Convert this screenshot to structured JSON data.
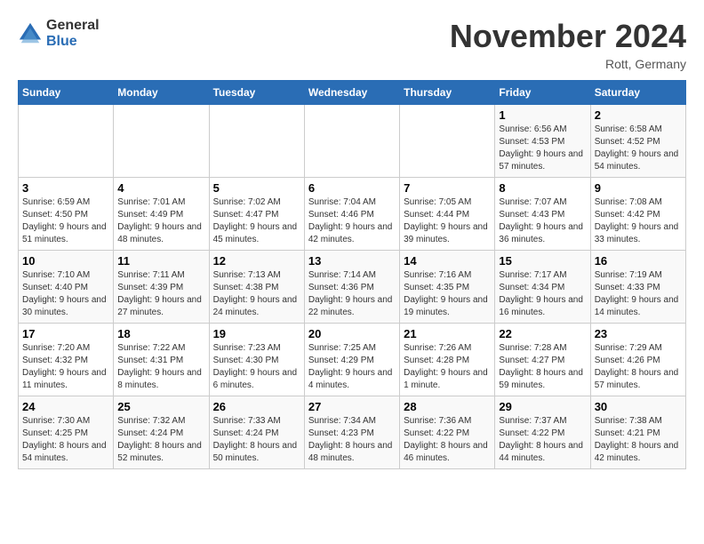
{
  "logo": {
    "general": "General",
    "blue": "Blue"
  },
  "title": "November 2024",
  "location": "Rott, Germany",
  "days_of_week": [
    "Sunday",
    "Monday",
    "Tuesday",
    "Wednesday",
    "Thursday",
    "Friday",
    "Saturday"
  ],
  "weeks": [
    [
      {
        "day": "",
        "info": ""
      },
      {
        "day": "",
        "info": ""
      },
      {
        "day": "",
        "info": ""
      },
      {
        "day": "",
        "info": ""
      },
      {
        "day": "",
        "info": ""
      },
      {
        "day": "1",
        "info": "Sunrise: 6:56 AM\nSunset: 4:53 PM\nDaylight: 9 hours and 57 minutes."
      },
      {
        "day": "2",
        "info": "Sunrise: 6:58 AM\nSunset: 4:52 PM\nDaylight: 9 hours and 54 minutes."
      }
    ],
    [
      {
        "day": "3",
        "info": "Sunrise: 6:59 AM\nSunset: 4:50 PM\nDaylight: 9 hours and 51 minutes."
      },
      {
        "day": "4",
        "info": "Sunrise: 7:01 AM\nSunset: 4:49 PM\nDaylight: 9 hours and 48 minutes."
      },
      {
        "day": "5",
        "info": "Sunrise: 7:02 AM\nSunset: 4:47 PM\nDaylight: 9 hours and 45 minutes."
      },
      {
        "day": "6",
        "info": "Sunrise: 7:04 AM\nSunset: 4:46 PM\nDaylight: 9 hours and 42 minutes."
      },
      {
        "day": "7",
        "info": "Sunrise: 7:05 AM\nSunset: 4:44 PM\nDaylight: 9 hours and 39 minutes."
      },
      {
        "day": "8",
        "info": "Sunrise: 7:07 AM\nSunset: 4:43 PM\nDaylight: 9 hours and 36 minutes."
      },
      {
        "day": "9",
        "info": "Sunrise: 7:08 AM\nSunset: 4:42 PM\nDaylight: 9 hours and 33 minutes."
      }
    ],
    [
      {
        "day": "10",
        "info": "Sunrise: 7:10 AM\nSunset: 4:40 PM\nDaylight: 9 hours and 30 minutes."
      },
      {
        "day": "11",
        "info": "Sunrise: 7:11 AM\nSunset: 4:39 PM\nDaylight: 9 hours and 27 minutes."
      },
      {
        "day": "12",
        "info": "Sunrise: 7:13 AM\nSunset: 4:38 PM\nDaylight: 9 hours and 24 minutes."
      },
      {
        "day": "13",
        "info": "Sunrise: 7:14 AM\nSunset: 4:36 PM\nDaylight: 9 hours and 22 minutes."
      },
      {
        "day": "14",
        "info": "Sunrise: 7:16 AM\nSunset: 4:35 PM\nDaylight: 9 hours and 19 minutes."
      },
      {
        "day": "15",
        "info": "Sunrise: 7:17 AM\nSunset: 4:34 PM\nDaylight: 9 hours and 16 minutes."
      },
      {
        "day": "16",
        "info": "Sunrise: 7:19 AM\nSunset: 4:33 PM\nDaylight: 9 hours and 14 minutes."
      }
    ],
    [
      {
        "day": "17",
        "info": "Sunrise: 7:20 AM\nSunset: 4:32 PM\nDaylight: 9 hours and 11 minutes."
      },
      {
        "day": "18",
        "info": "Sunrise: 7:22 AM\nSunset: 4:31 PM\nDaylight: 9 hours and 8 minutes."
      },
      {
        "day": "19",
        "info": "Sunrise: 7:23 AM\nSunset: 4:30 PM\nDaylight: 9 hours and 6 minutes."
      },
      {
        "day": "20",
        "info": "Sunrise: 7:25 AM\nSunset: 4:29 PM\nDaylight: 9 hours and 4 minutes."
      },
      {
        "day": "21",
        "info": "Sunrise: 7:26 AM\nSunset: 4:28 PM\nDaylight: 9 hours and 1 minute."
      },
      {
        "day": "22",
        "info": "Sunrise: 7:28 AM\nSunset: 4:27 PM\nDaylight: 8 hours and 59 minutes."
      },
      {
        "day": "23",
        "info": "Sunrise: 7:29 AM\nSunset: 4:26 PM\nDaylight: 8 hours and 57 minutes."
      }
    ],
    [
      {
        "day": "24",
        "info": "Sunrise: 7:30 AM\nSunset: 4:25 PM\nDaylight: 8 hours and 54 minutes."
      },
      {
        "day": "25",
        "info": "Sunrise: 7:32 AM\nSunset: 4:24 PM\nDaylight: 8 hours and 52 minutes."
      },
      {
        "day": "26",
        "info": "Sunrise: 7:33 AM\nSunset: 4:24 PM\nDaylight: 8 hours and 50 minutes."
      },
      {
        "day": "27",
        "info": "Sunrise: 7:34 AM\nSunset: 4:23 PM\nDaylight: 8 hours and 48 minutes."
      },
      {
        "day": "28",
        "info": "Sunrise: 7:36 AM\nSunset: 4:22 PM\nDaylight: 8 hours and 46 minutes."
      },
      {
        "day": "29",
        "info": "Sunrise: 7:37 AM\nSunset: 4:22 PM\nDaylight: 8 hours and 44 minutes."
      },
      {
        "day": "30",
        "info": "Sunrise: 7:38 AM\nSunset: 4:21 PM\nDaylight: 8 hours and 42 minutes."
      }
    ]
  ]
}
